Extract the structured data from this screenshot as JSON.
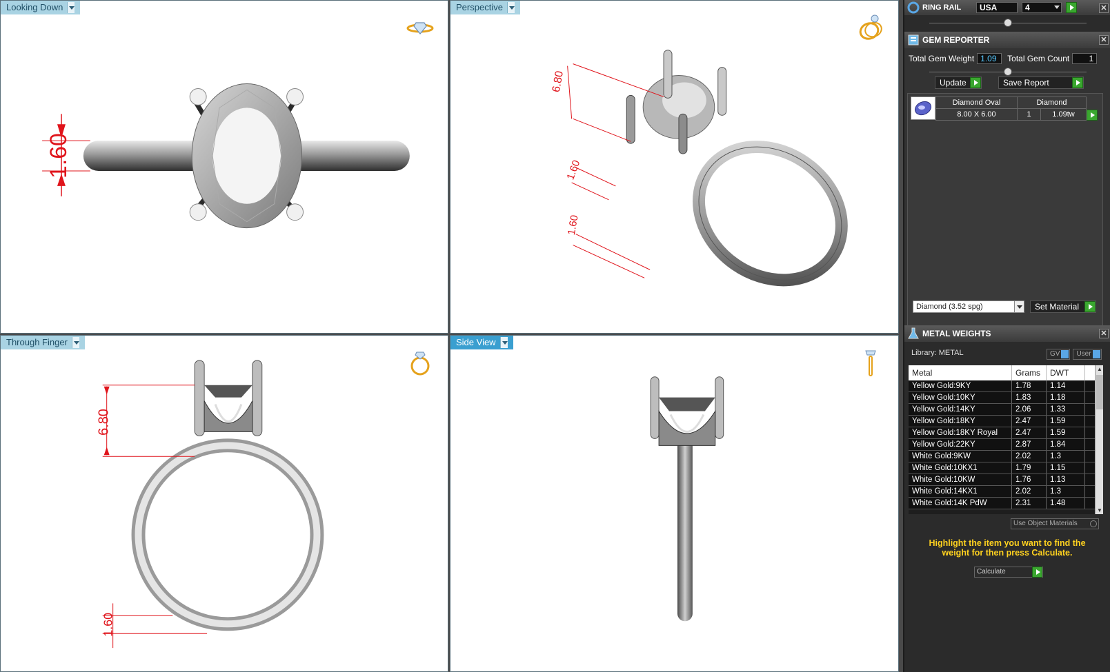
{
  "viewports": {
    "top_left": {
      "label": "Looking Down",
      "dim": "1.60"
    },
    "top_right": {
      "label": "Perspective",
      "dims": [
        "6.80",
        "1.60",
        "1.60"
      ]
    },
    "bottom_left": {
      "label": "Through Finger",
      "dims": [
        "6.80",
        "1.60"
      ]
    },
    "bottom_right": {
      "label": "Side View"
    }
  },
  "ring_rail": {
    "title": "RING RAIL",
    "region": "USA",
    "size": "4"
  },
  "gem_reporter": {
    "title": "GEM REPORTER",
    "total_weight_label": "Total Gem Weight",
    "total_weight": "1.09",
    "total_count_label": "Total Gem Count",
    "total_count": "1",
    "update_label": "Update",
    "save_label": "Save Report",
    "gem": {
      "name": "Diamond Oval",
      "size": "8.00 X 6.00",
      "material": "Diamond",
      "count": "1",
      "weight": "1.09tw"
    },
    "material_select": "Diamond    (3.52 spg)",
    "set_material_label": "Set Material"
  },
  "metal_weights": {
    "title": "METAL WEIGHTS",
    "library_label": "Library: METAL",
    "gv_label": "GV",
    "user_label": "User",
    "columns": [
      "Metal",
      "Grams",
      "DWT"
    ],
    "rows": [
      [
        "Yellow Gold:9KY",
        "1.78",
        "1.14"
      ],
      [
        "Yellow Gold:10KY",
        "1.83",
        "1.18"
      ],
      [
        "Yellow Gold:14KY",
        "2.06",
        "1.33"
      ],
      [
        "Yellow Gold:18KY",
        "2.47",
        "1.59"
      ],
      [
        "Yellow Gold:18KY Royal",
        "2.47",
        "1.59"
      ],
      [
        "Yellow Gold:22KY",
        "2.87",
        "1.84"
      ],
      [
        "White Gold:9KW",
        "2.02",
        "1.3"
      ],
      [
        "White Gold:10KX1",
        "1.79",
        "1.15"
      ],
      [
        "White Gold:10KW",
        "1.76",
        "1.13"
      ],
      [
        "White Gold:14KX1",
        "2.02",
        "1.3"
      ],
      [
        "White Gold:14K PdW",
        "2.31",
        "1.48"
      ]
    ],
    "use_object_materials": "Use Object Materials",
    "instruction": "Highlight the item you want to find the weight for then press Calculate.",
    "calculate_label": "Calculate"
  },
  "colors": {
    "accent_text": "#ffd21f",
    "value_text": "#56c9ff",
    "dimension_red": "#e0141b",
    "go_green": "#3aa72f"
  }
}
